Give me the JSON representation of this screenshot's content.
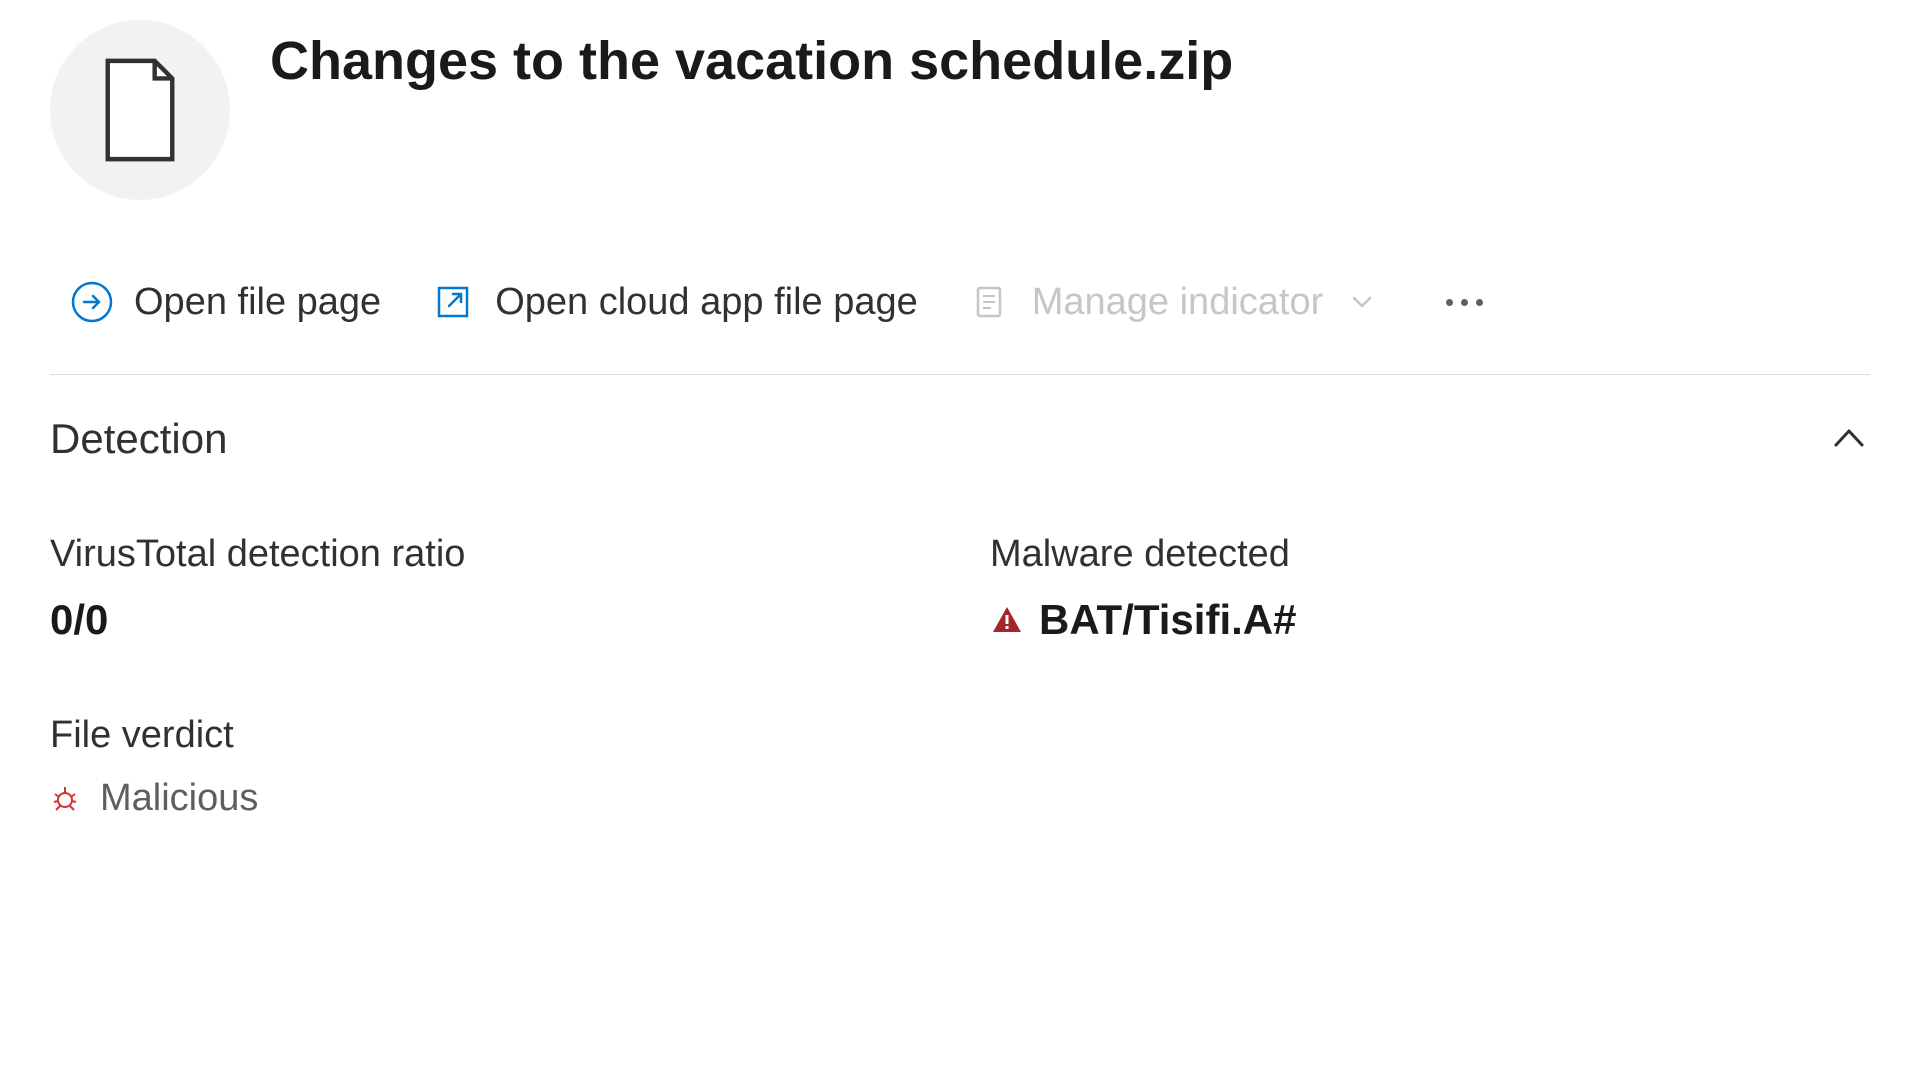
{
  "header": {
    "title": "Changes to the vacation schedule.zip"
  },
  "toolbar": {
    "open_file_page": "Open file page",
    "open_cloud_app": "Open cloud app file page",
    "manage_indicator": "Manage indicator"
  },
  "detection": {
    "section_title": "Detection",
    "virus_total_label": "VirusTotal detection ratio",
    "virus_total_value": "0/0",
    "malware_detected_label": "Malware detected",
    "malware_detected_value": "BAT/Tisifi.A#",
    "file_verdict_label": "File verdict",
    "file_verdict_value": "Malicious"
  }
}
